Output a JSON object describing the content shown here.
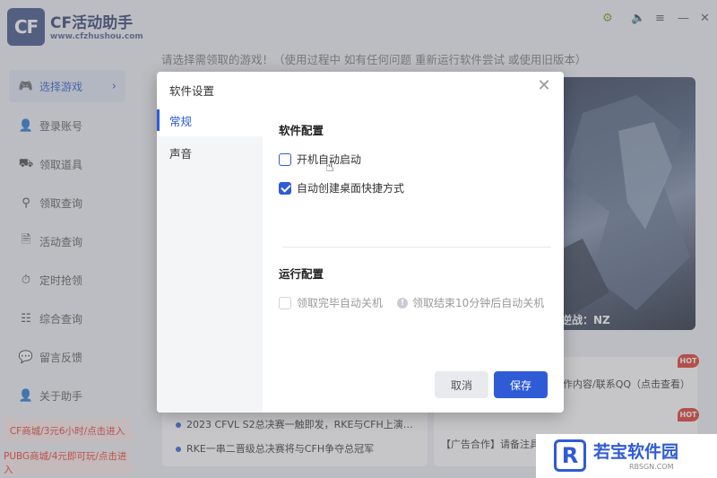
{
  "app": {
    "logo_text": "CF",
    "name": "CF活动助手",
    "url": "www.cfzhushou.com",
    "window_controls": [
      "⚙",
      "🔈",
      "≡",
      "—",
      "✕"
    ]
  },
  "sidebar": {
    "items": [
      {
        "label": "选择游戏",
        "icon": "gamepad-icon",
        "glyph": "🎮"
      },
      {
        "label": "登录账号",
        "icon": "user-icon",
        "glyph": "👤"
      },
      {
        "label": "领取道具",
        "icon": "gift-icon",
        "glyph": "⛟"
      },
      {
        "label": "领取查询",
        "icon": "search-icon",
        "glyph": "⚲"
      },
      {
        "label": "活动查询",
        "icon": "document-search-icon",
        "glyph": "🗎"
      },
      {
        "label": "定时抢领",
        "icon": "timer-icon",
        "glyph": "⏱"
      },
      {
        "label": "综合查询",
        "icon": "list-icon",
        "glyph": "☷"
      },
      {
        "label": "留言反馈",
        "icon": "message-icon",
        "glyph": "💬"
      },
      {
        "label": "关于助手",
        "icon": "user-info-icon",
        "glyph": "👤"
      }
    ],
    "promos": [
      "CF商城/3元6小时/点击进入",
      "PUBG商城/4元即可玩/点击进入"
    ]
  },
  "main": {
    "notice": "请选择需领取的游戏！（使用过程中 如有任何问题 重新运行软件尝试 或使用旧版本）",
    "banner_text": "逆战：NZ",
    "news": [
      "2023 CFVL S2总决赛一触即发，RKE与CFH上演…",
      "RKE一串二晋级总决赛将与CFH争夺总冠军"
    ],
    "ads": [
      "作内容/联系QQ（点击查看）",
      "【广告合作】请备注具"
    ],
    "hot_badge": "HOT"
  },
  "dialog": {
    "title": "软件设置",
    "close": "✕",
    "tabs": [
      "常规",
      "声音"
    ],
    "section1": "软件配置",
    "opt_autostart": "开机自动启动",
    "opt_shortcut": "自动创建桌面快捷方式",
    "section2": "运行配置",
    "opt_shutdown": "领取完毕自动关机",
    "shutdown_hint": "领取结束10分钟后自动关机",
    "cancel": "取消",
    "save": "保存"
  },
  "watermark": {
    "letter": "R",
    "text": "若宝软件园",
    "sub": "RBSGN.COM"
  },
  "colors": {
    "accent": "#2f5bd6",
    "promo": "#e03b2f",
    "hot": "#e0342a"
  }
}
